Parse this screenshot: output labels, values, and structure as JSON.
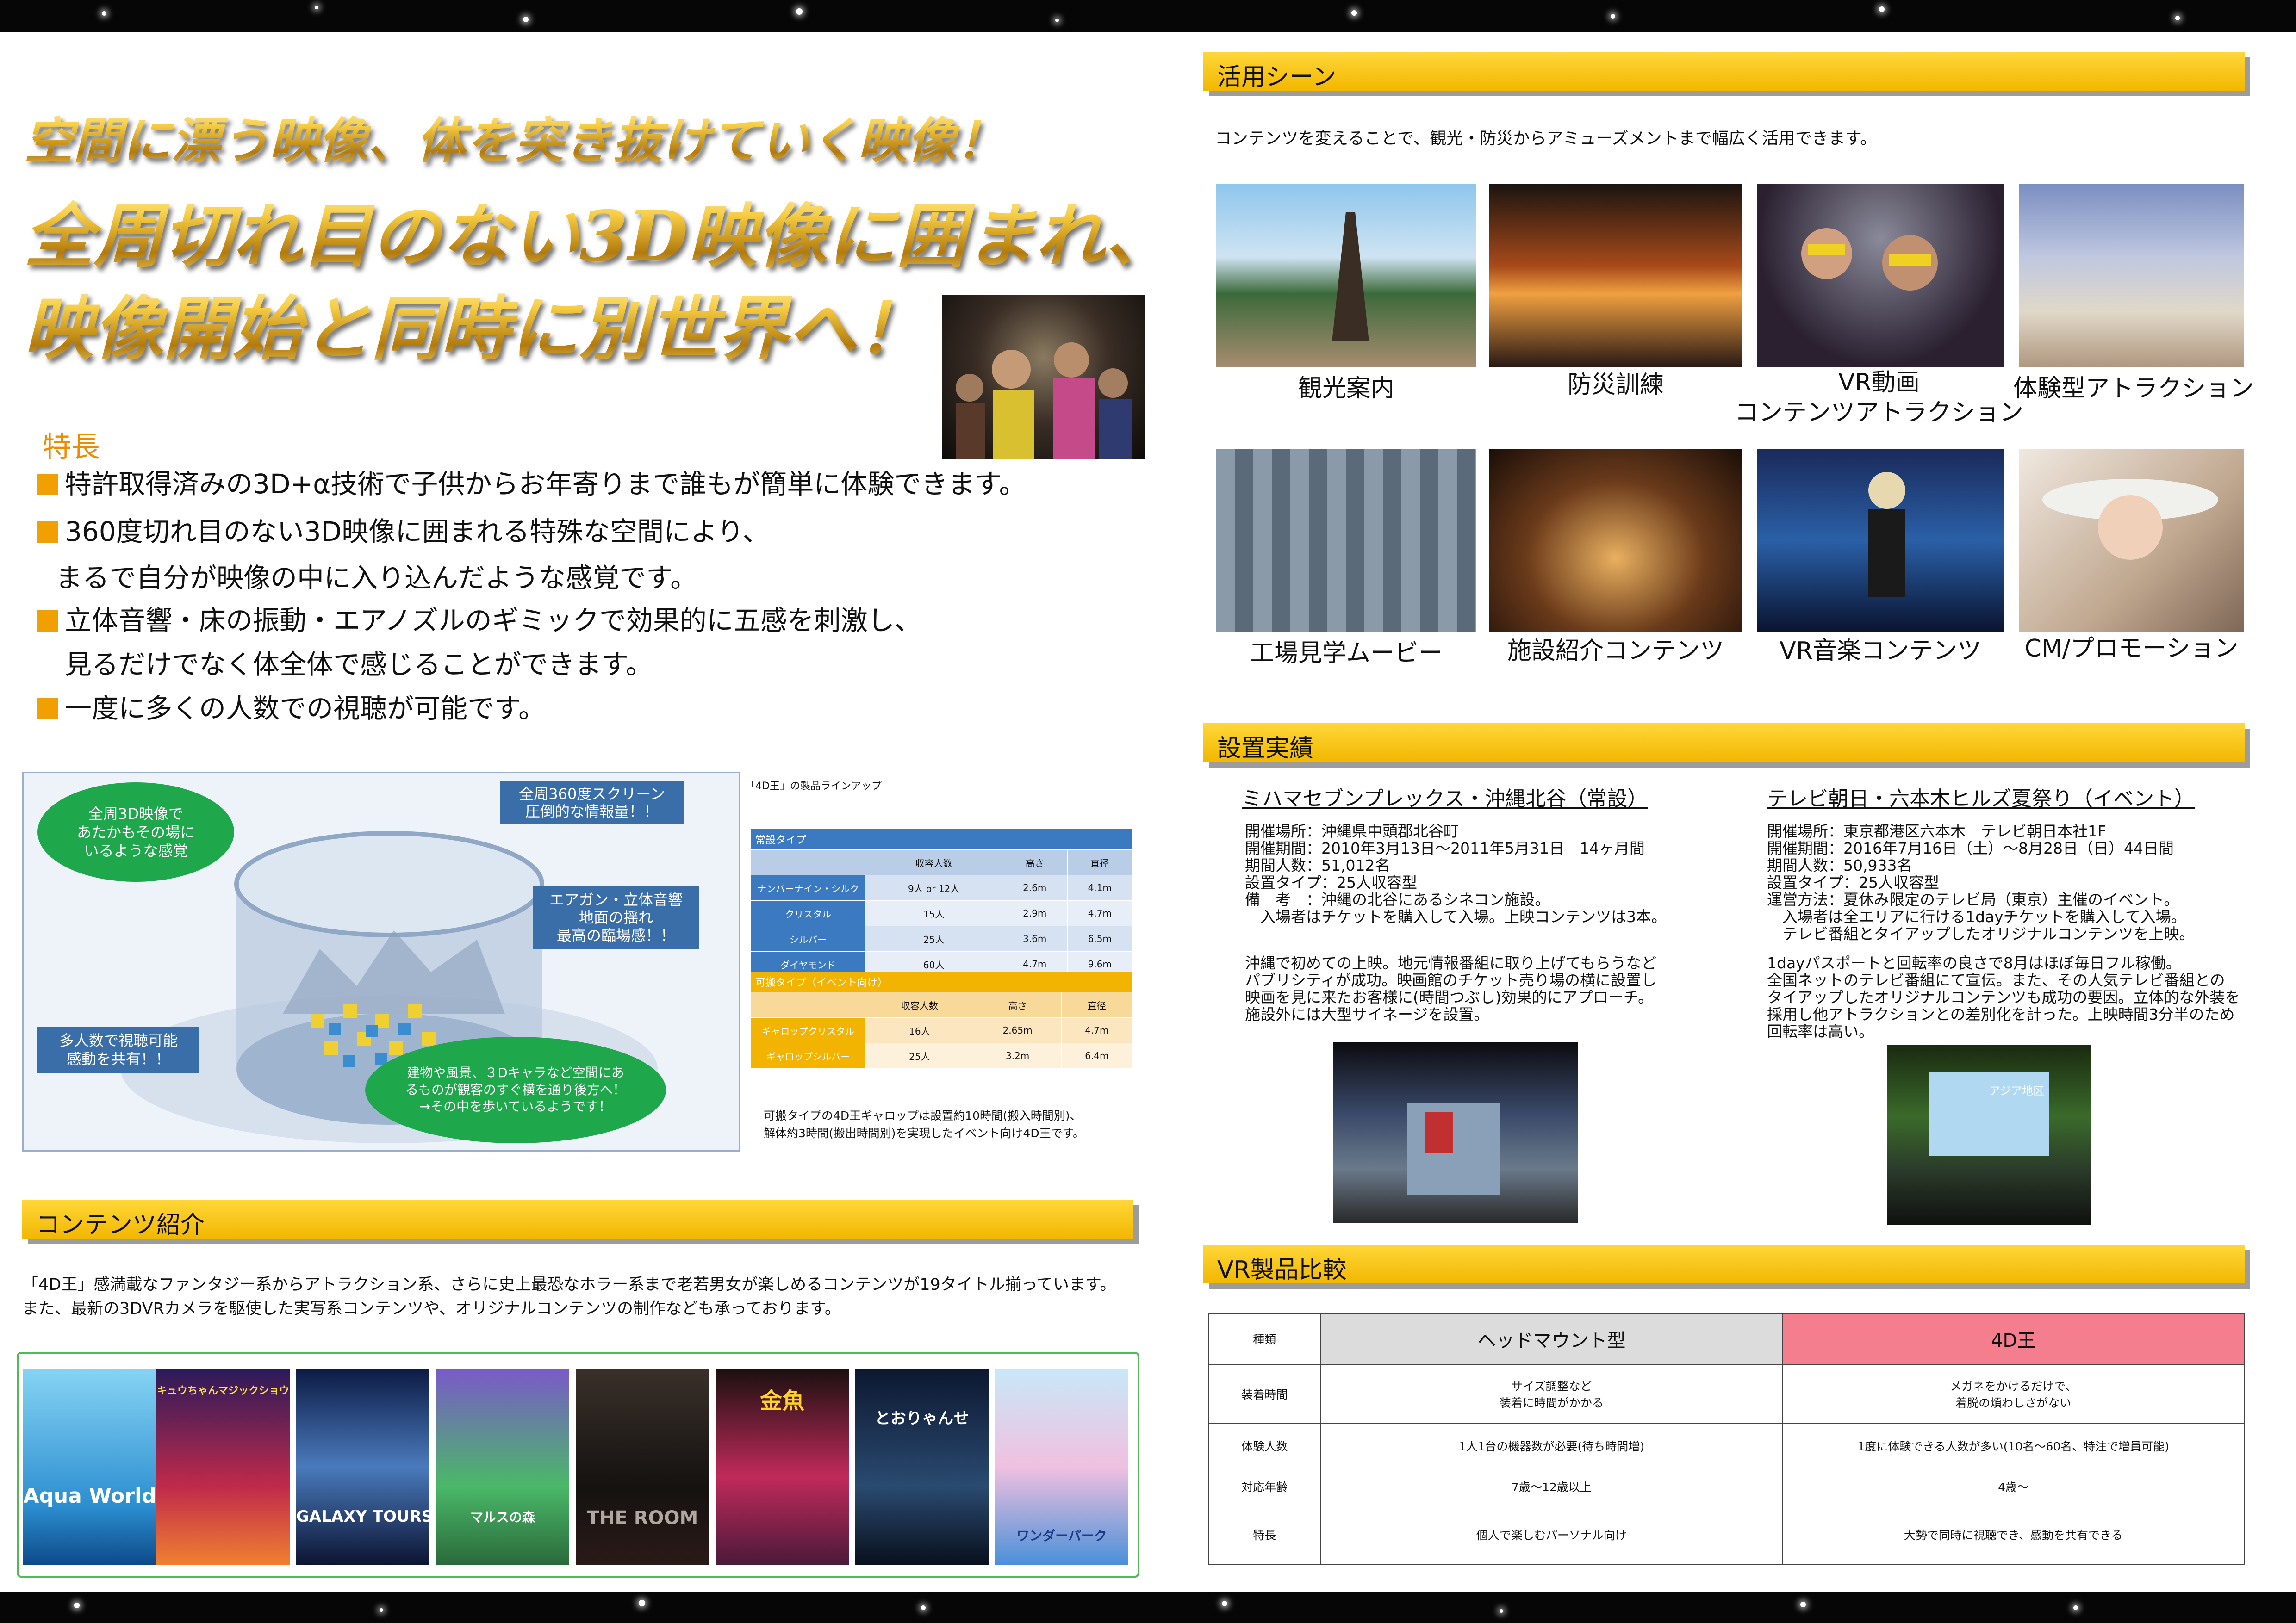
{
  "headline": {
    "line1": "空間に漂う映像、体を突き抜けていく映像！",
    "line2": "全周切れ目のない3D映像に囲まれ、",
    "line3": "映像開始と同時に別世界へ！"
  },
  "features": {
    "title": "特長",
    "items": [
      "特許取得済みの3D+α技術で子供からお年寄りまで誰もが簡単に体験できます。",
      "360度切れ目のない3D映像に囲まれる特殊な空間により、",
      "まるで自分が映像の中に入り込んだような感覚です。",
      "立体音響・床の振動・エアノズルのギミックで効果的に五感を刺激し、",
      "見るだけでなく体全体で感じることができます。",
      "一度に多くの人数での視聴が可能です。"
    ]
  },
  "diagram": {
    "bubble_left": "全周3D映像で\nあたかもその場に\nいるような感覚",
    "box_screen": "全周360度スクリーン\n圧倒的な情報量！！",
    "box_sound": "エアガン・立体音響\n地面の揺れ\n最高の臨場感！！",
    "box_many": "多人数で視聴可能\n感動を共有！！",
    "bubble_bottom": "建物や風景、３Dキャラなど空間にあ\nるものが観客のすぐ横を通り後方へ！\n→その中を歩いているようです！"
  },
  "lineup": {
    "title": "「4D王」の製品ラインアップ",
    "fixed_header": "常設タイプ",
    "columns": [
      "収容人数",
      "高さ",
      "直径"
    ],
    "fixed_rows": [
      [
        "ナンバーナイン・シルク",
        "9人 or 12人",
        "2.6m",
        "4.1m"
      ],
      [
        "クリスタル",
        "15人",
        "2.9m",
        "4.7m"
      ],
      [
        "シルバー",
        "25人",
        "3.6m",
        "6.5m"
      ],
      [
        "ダイヤモンド",
        "60人",
        "4.7m",
        "9.6m"
      ]
    ],
    "portable_header": "可搬タイプ（イベント向け）",
    "portable_rows": [
      [
        "ギャロップクリスタル",
        "16人",
        "2.65m",
        "4.7m"
      ],
      [
        "ギャロップシルバー",
        "25人",
        "3.2m",
        "6.4m"
      ]
    ],
    "note1": "可搬タイプの4D王ギャロップは設置約10時間(搬入時間別)、",
    "note2": "解体約3時間(搬出時間別)を実現したイベント向け4D王です。"
  },
  "contents": {
    "header": "コンテンツ紹介",
    "text1": "「4D王」感満載なファンタジー系からアトラクション系、さらに史上最恐なホラー系まで老若男女が楽しめるコンテンツが19タイトル揃っています。",
    "text2": "また、最新の3DVRカメラを駆使した実写系コンテンツや、オリジナルコンテンツの制作なども承っております。",
    "posters": [
      "Aqua World",
      "キュウちゃんマジックショウ",
      "GALAXY TOURS",
      "マルスの森",
      "THE ROOM",
      "金魚",
      "とおりゃんせ",
      "ワンダーパーク"
    ]
  },
  "usage": {
    "header": "活用シーン",
    "text": "コンテンツを変えることで、観光・防災からアミューズメントまで幅広く活用できます。",
    "captions": [
      "観光案内",
      "防災訓練",
      "VR動画\nコンテンツアトラクション",
      "体験型アトラクション",
      "工場見学ムービー",
      "施設紹介コンテンツ",
      "VR音楽コンテンツ",
      "CM/プロモーション"
    ]
  },
  "installs": {
    "header": "設置実績",
    "left": {
      "title": "ミハマセブンプレックス・沖縄北谷（常設）",
      "lines": [
        "開催場所：沖縄県中頭郡北谷町",
        "開催期間：2010年3月13日～2011年5月31日　14ヶ月間",
        "期間人数：51,012名",
        "設置タイプ：25人収容型",
        "備　考　：沖縄の北谷にあるシネコン施設。",
        "　入場者はチケットを購入して入場。上映コンテンツは3本。",
        "",
        "沖縄で初めての上映。地元情報番組に取り上げてもらうなど",
        "パブリシティが成功。映画館のチケット売り場の横に設置し",
        "映画を見に来たお客様に(時間つぶし)効果的にアプローチ。",
        "施設外には大型サイネージを設置。"
      ]
    },
    "right": {
      "title": "テレビ朝日・六本木ヒルズ夏祭り（イベント）",
      "lines": [
        "開催場所：東京都港区六本木　テレビ朝日本社1F",
        "開催期間：2016年7月16日（土）～8月28日（日）44日間",
        "期間人数：50,933名",
        "設置タイプ：25人収容型",
        "運営方法：夏休み限定のテレビ局（東京）主催のイベント。",
        "　入場者は全エリアに行ける1dayチケットを購入して入場。",
        "　テレビ番組とタイアップしたオリジナルコンテンツを上映。",
        "",
        "1dayパスポートと回転率の良さで8月はほぼ毎日フル稼働。",
        "全国ネットのテレビ番組にて宣伝。また、その人気テレビ番組との",
        "タイアップしたオリジナルコンテンツも成功の要因。立体的な外装を",
        "採用し他アトラクションとの差別化を計った。上映時間3分半のため",
        "回転率は高い。"
      ]
    },
    "photo_sign": "アジア地区"
  },
  "compare": {
    "header": "VR製品比較",
    "col_kind": "種類",
    "col_hmd": "ヘッドマウント型",
    "col_4d": "4D王",
    "rows": [
      {
        "label": "装着時間",
        "hmd": "サイズ調整など\n装着に時間がかかる",
        "d4": "メガネをかけるだけで、\n着脱の煩わしさがない"
      },
      {
        "label": "体験人数",
        "hmd": "1人1台の機器数が必要(待ち時間増)",
        "d4": "1度に体験できる人数が多い(10名～60名、特注で増員可能)"
      },
      {
        "label": "対応年齢",
        "hmd": "7歳～12歳以上",
        "d4": "4歳～"
      },
      {
        "label": "特長",
        "hmd": "個人で楽しむパーソナル向け",
        "d4": "大勢で同時に視聴でき、感動を共有できる"
      }
    ]
  },
  "colors": {
    "accent": "#f2b700",
    "blue": "#3a6ea8",
    "green": "#1ea84b",
    "pink": "#f47e8e"
  }
}
